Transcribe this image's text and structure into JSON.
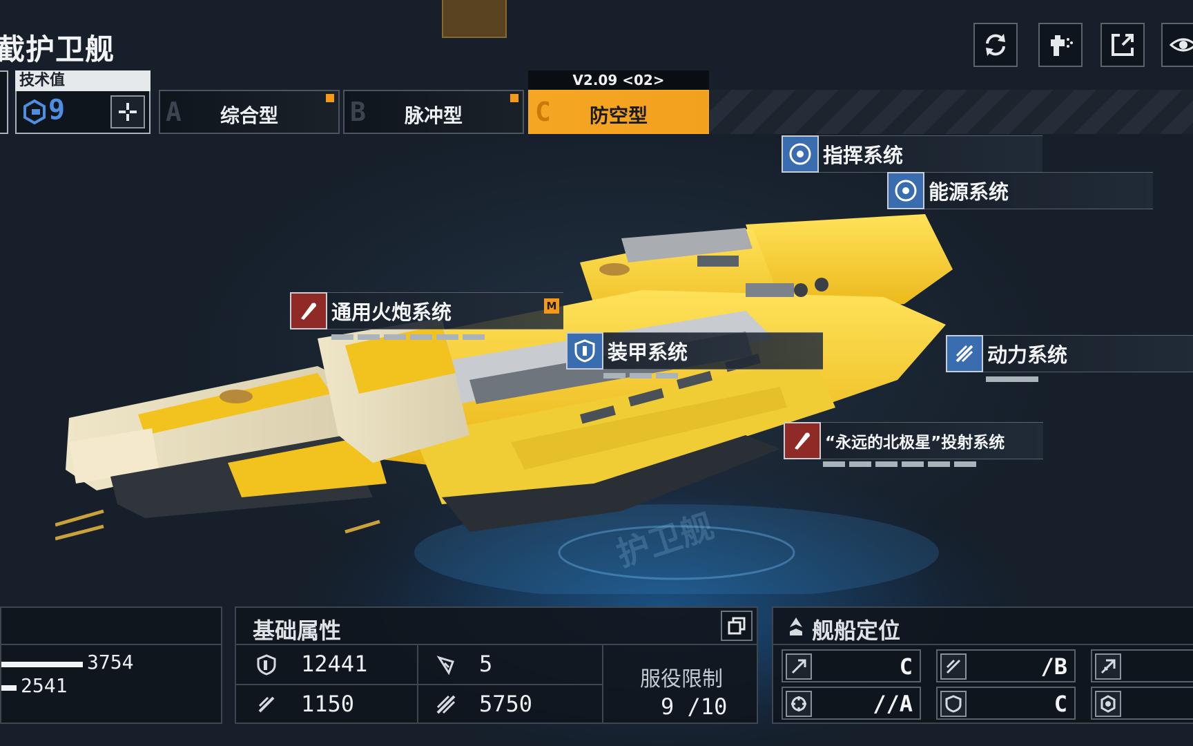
{
  "header": {
    "ship_title": "截护卫舰"
  },
  "toolbar": {
    "buttons": [
      "refresh-icon",
      "paint-spray-icon",
      "share-icon",
      "view-icon"
    ]
  },
  "tech": {
    "label": "技术值",
    "value": "9"
  },
  "variants": {
    "version": "V2.09 <02>",
    "tabs": [
      {
        "letter": "A",
        "name": "综合型"
      },
      {
        "letter": "B",
        "name": "脉冲型"
      },
      {
        "letter": "C",
        "name": "防空型"
      }
    ],
    "active_index": 2
  },
  "systems": {
    "command": "指挥系统",
    "energy": "能源系统",
    "cannon": "通用火炮系统",
    "cannon_tag": "M",
    "armor": "装甲系统",
    "power": "动力系统",
    "launch": "“永远的北极星”投射系统"
  },
  "left_panel": {
    "bar_values": [
      "3754",
      "2541"
    ]
  },
  "base_panel": {
    "title": "基础属性",
    "hp": "12441",
    "evasion": "5",
    "speed": "1150",
    "warp_speed": "5750",
    "service_label": "服役限制",
    "service_value": "9 /10"
  },
  "role_panel": {
    "title": "舰船定位",
    "cells": [
      {
        "icon": "attack-icon",
        "value": "C"
      },
      {
        "icon": "anti-air-icon",
        "value": "/B"
      },
      {
        "icon": "siege-icon",
        "value": ""
      },
      {
        "icon": "target-icon",
        "value": "//A"
      },
      {
        "icon": "shield-icon",
        "value": "C"
      },
      {
        "icon": "support-gear-icon",
        "value": ""
      }
    ]
  },
  "colors": {
    "accent": "#f5a623",
    "ship_yellow": "#f2c21e",
    "badge_blue": "#3a6cb0",
    "badge_red": "#8f2a26"
  }
}
